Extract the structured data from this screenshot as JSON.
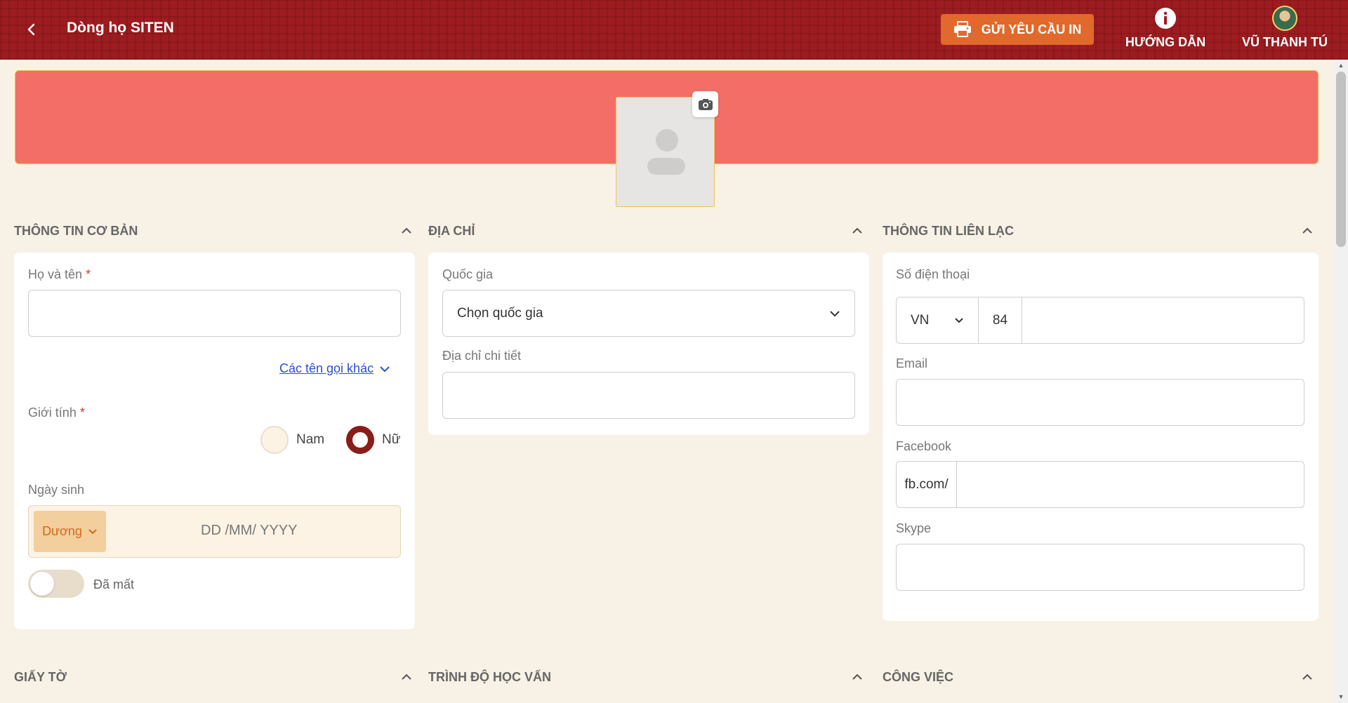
{
  "header": {
    "title": "Dòng họ SITEN",
    "print_button": "GỬI YÊU CẦU IN",
    "guide_label": "HƯỚNG DẪN",
    "user_name": "VŨ THANH TÚ",
    "colors": {
      "background": "#9d1c20",
      "print_button": "#e0692b"
    }
  },
  "banner": {
    "color": "#f26e67"
  },
  "sections": {
    "basic": {
      "title": "THÔNG TIN CƠ BẢN",
      "full_name_label": "Họ và tên",
      "required_mark": "*",
      "full_name_value": "",
      "other_names_link": "Các tên gọi khác",
      "gender_label": "Giới tính",
      "gender_options": [
        "Nam",
        "Nữ"
      ],
      "gender_selected": "Nữ",
      "birth_label": "Ngày sinh",
      "calendar_type": "Dương",
      "date_placeholder": "DD /MM/ YYYY",
      "deceased_label": "Đã mất",
      "deceased": false
    },
    "address": {
      "title": "ĐỊA CHỈ",
      "country_label": "Quốc gia",
      "country_value": "Chọn quốc gia",
      "detail_label": "Địa chỉ chi tiết",
      "detail_value": ""
    },
    "contact": {
      "title": "THÔNG TIN LIÊN LẠC",
      "phone_label": "Số điện thoại",
      "phone_country": "VN",
      "phone_code": "84",
      "phone_value": "",
      "email_label": "Email",
      "email_value": "",
      "facebook_label": "Facebook",
      "facebook_prefix": "fb.com/",
      "facebook_value": "",
      "skype_label": "Skype",
      "skype_value": ""
    },
    "documents": {
      "title": "GIẤY TỜ"
    },
    "education": {
      "title": "TRÌNH ĐỘ HỌC VẤN"
    },
    "work": {
      "title": "CÔNG VIỆC"
    }
  },
  "icons": {
    "back": "chevron-left-icon",
    "print": "printer-icon",
    "guide": "info-icon",
    "camera": "camera-icon",
    "collapse": "chevron-up-icon",
    "dropdown": "chevron-down-icon"
  }
}
